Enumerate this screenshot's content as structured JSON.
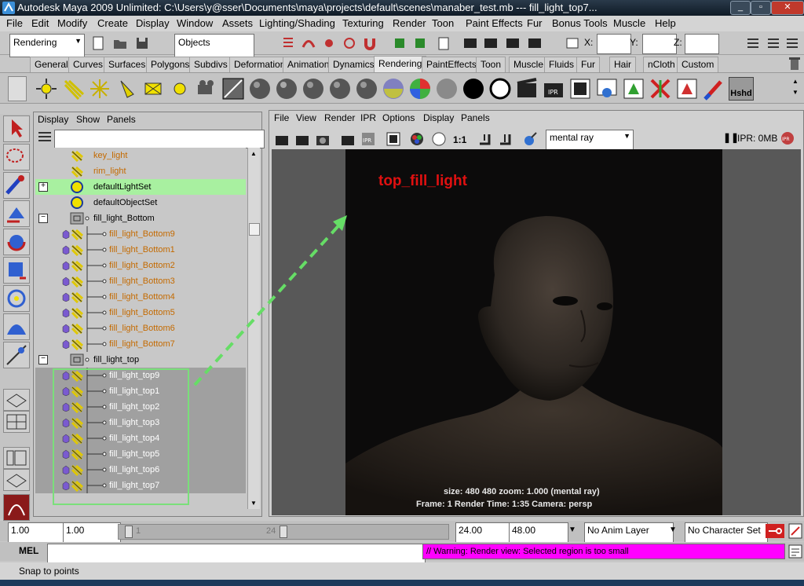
{
  "window": {
    "title": "Autodesk Maya 2009 Unlimited: C:\\Users\\y@sser\\Documents\\maya\\projects\\default\\scenes\\manaber_test.mb  ---  fill_light_top7..."
  },
  "menubar": {
    "items": [
      "File",
      "Edit",
      "Modify",
      "Create",
      "Display",
      "Window",
      "Assets",
      "Lighting/Shading",
      "Texturing",
      "Render",
      "Toon",
      "Paint Effects",
      "Fur",
      "Bonus Tools",
      "Muscle",
      "Help"
    ]
  },
  "status": {
    "mode": "Rendering",
    "objects": "Objects",
    "x_label": "X:",
    "y_label": "Y:",
    "z_label": "Z:"
  },
  "shelf_tabs": {
    "items": [
      "General",
      "Curves",
      "Surfaces",
      "Polygons",
      "Subdivs",
      "Deformation",
      "Animation",
      "Dynamics",
      "Rendering",
      "PaintEffects",
      "Toon",
      "Muscle",
      "Fluids",
      "Fur",
      "Hair",
      "nCloth",
      "Custom"
    ],
    "active": "Rendering",
    "hshd": "Hshd"
  },
  "outliner": {
    "menu": [
      "Display",
      "Show",
      "Panels"
    ],
    "rows": [
      {
        "label": "key_light",
        "color": "orange",
        "indent": 0
      },
      {
        "label": "rim_light",
        "color": "orange",
        "indent": 0
      },
      {
        "label": "defaultLightSet",
        "color": "black",
        "indent": 0,
        "highlight": true,
        "expander": "+"
      },
      {
        "label": "defaultObjectSet",
        "color": "black",
        "indent": 0
      },
      {
        "label": "fill_light_Bottom",
        "color": "black",
        "indent": 0,
        "expander": "−",
        "group": true
      },
      {
        "label": "fill_light_Bottom9",
        "color": "orange",
        "indent": 1
      },
      {
        "label": "fill_light_Bottom1",
        "color": "orange",
        "indent": 1
      },
      {
        "label": "fill_light_Bottom2",
        "color": "orange",
        "indent": 1
      },
      {
        "label": "fill_light_Bottom3",
        "color": "orange",
        "indent": 1
      },
      {
        "label": "fill_light_Bottom4",
        "color": "orange",
        "indent": 1
      },
      {
        "label": "fill_light_Bottom5",
        "color": "orange",
        "indent": 1
      },
      {
        "label": "fill_light_Bottom6",
        "color": "orange",
        "indent": 1
      },
      {
        "label": "fill_light_Bottom7",
        "color": "orange",
        "indent": 1
      },
      {
        "label": "fill_light_top",
        "color": "black",
        "indent": 0,
        "expander": "−",
        "group": true
      },
      {
        "label": "fill_light_top9",
        "color": "white",
        "indent": 1,
        "selected": true
      },
      {
        "label": "fill_light_top1",
        "color": "white",
        "indent": 1,
        "selected": true
      },
      {
        "label": "fill_light_top2",
        "color": "white",
        "indent": 1,
        "selected": true
      },
      {
        "label": "fill_light_top3",
        "color": "white",
        "indent": 1,
        "selected": true
      },
      {
        "label": "fill_light_top4",
        "color": "white",
        "indent": 1,
        "selected": true
      },
      {
        "label": "fill_light_top5",
        "color": "white",
        "indent": 1,
        "selected": true
      },
      {
        "label": "fill_light_top6",
        "color": "white",
        "indent": 1,
        "selected": true
      },
      {
        "label": "fill_light_top7",
        "color": "white",
        "indent": 1,
        "selected": true
      }
    ]
  },
  "render_view": {
    "menu": [
      "File",
      "View",
      "Render",
      "IPR",
      "Options",
      "Display",
      "Panels"
    ],
    "ratio": "1:1",
    "renderer": "mental ray",
    "ipr_status": "IPR: 0MB",
    "annotation": "top_fill_light",
    "info_line1": "size:  480  480 zoom: 1.000      (mental ray)",
    "info_line2": "Frame: 1       Render Time: 1:35       Camera: persp"
  },
  "timebar": {
    "start": "1.00",
    "current": "1.00",
    "slider_left": "1",
    "slider_right": "24",
    "end": "24.00",
    "range_end": "48.00",
    "anim_layer": "No Anim Layer",
    "char_set": "No Character Set"
  },
  "cmdline": {
    "label": "MEL",
    "warning": "// Warning: Render view: Selected region is too small"
  },
  "helpline": {
    "text": "Snap to points"
  },
  "colors": {
    "highlight_green": "#a8f0a0",
    "selection_gray": "#a0a0a0",
    "warning_magenta": "#ff00ff",
    "annotation_red": "#e01010",
    "arrow_green": "#66dd66"
  }
}
